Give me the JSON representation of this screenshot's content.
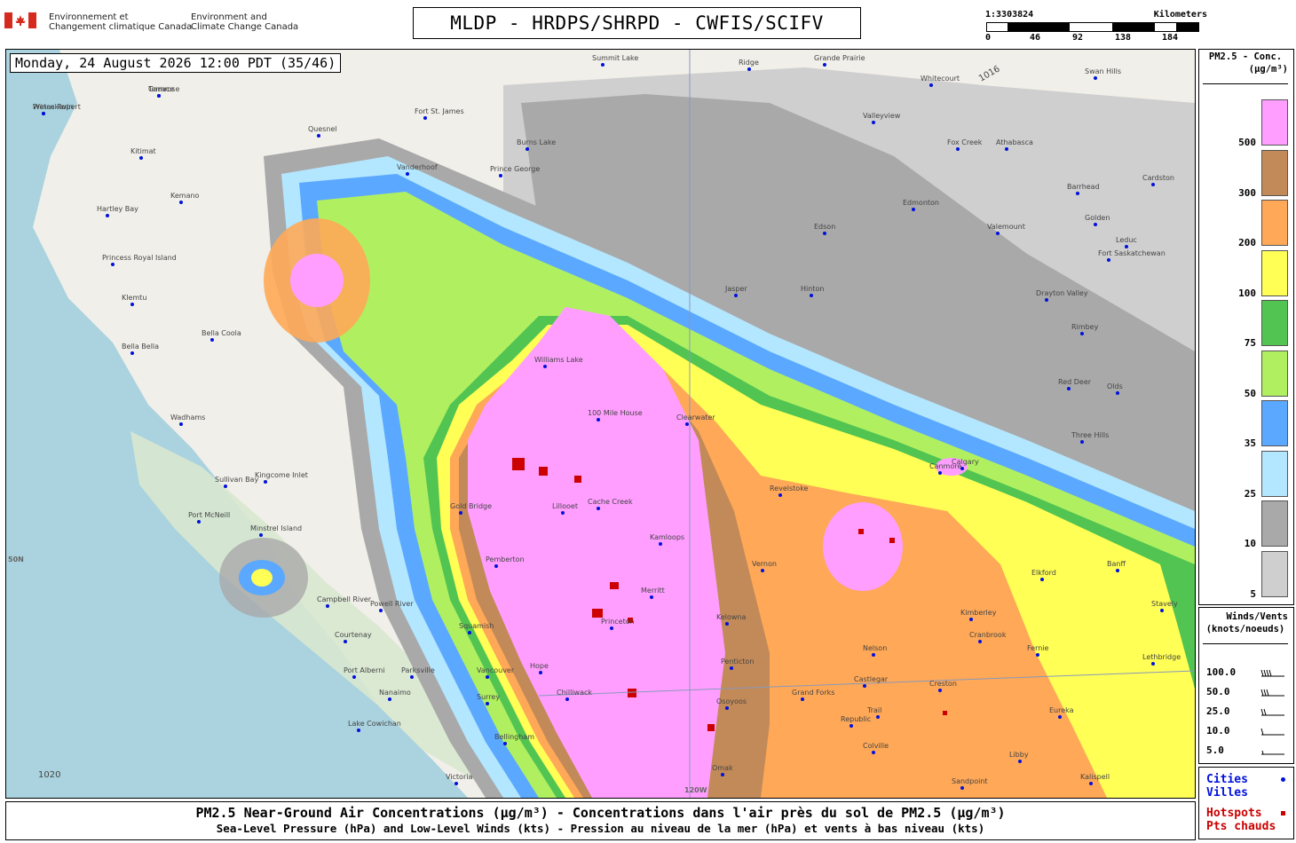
{
  "header": {
    "agency_fr_line1": "Environnement et",
    "agency_fr_line2": "Changement climatique Canada",
    "agency_en_line1": "Environment and",
    "agency_en_line2": "Climate Change Canada",
    "title": "MLDP - HRDPS/SHRPD - CWFIS/SCIFV",
    "scale_ratio": "1:3303824",
    "scale_unit": "Kilometers",
    "scale_ticks": [
      "0",
      "46",
      "92",
      "138",
      "184"
    ]
  },
  "map": {
    "datetime": "Monday, 24 August 2026 12:00 PDT (35/46)",
    "latitude_label": "50N",
    "longitude_label": "120W",
    "isobar_labels": [
      "1016",
      "1020"
    ],
    "place_labels": [
      "Prince Rupert",
      "Terrace",
      "Kitimat",
      "Kemano",
      "Hartley Bay",
      "Princess Royal Island",
      "Klemtu",
      "Bella Bella",
      "Bella Coola",
      "Wadhams",
      "Kingcome Inlet",
      "Sullivan Bay",
      "Port McNeill",
      "Minstrel Island",
      "Campbell River",
      "Courtenay",
      "Powell River",
      "Port Alberni",
      "Parksville",
      "Nanaimo",
      "Lake Cowichan",
      "Victoria",
      "Vancouver",
      "Surrey",
      "Bellingham",
      "Squamish",
      "Pemberton",
      "Gold Bridge",
      "Lillooet",
      "Cache Creek",
      "Kamloops",
      "Merritt",
      "Kelowna",
      "Penticton",
      "Osoyoos",
      "Chilliwack",
      "Hope",
      "Princeton",
      "Williams Lake",
      "100 Mile House",
      "Clearwater",
      "Revelstoke",
      "Vernon",
      "Nelson",
      "Castlegar",
      "Trail",
      "Cranbrook",
      "Kimberley",
      "Fernie",
      "Elkford",
      "Grand Forks",
      "Creston",
      "Libby",
      "Eureka",
      "Kalispell",
      "Sandpoint",
      "Omak",
      "Republic",
      "Colville",
      "Fort St. James",
      "Vanderhoof",
      "Prince George",
      "Quesnel",
      "Burns Lake",
      "Summit Lake",
      "Ridge",
      "Grande Prairie",
      "Valleyview",
      "Fox Creek",
      "Whitecourt",
      "Swan Hills",
      "Athabasca",
      "Barrhead",
      "Edmonton",
      "Edson",
      "Hinton",
      "Jasper",
      "Valemount",
      "Drayton Valley",
      "Rimbey",
      "Red Deer",
      "Olds",
      "Three Hills",
      "Calgary",
      "Canmore",
      "Banff",
      "Stavely",
      "Lethbridge",
      "Cardston",
      "Golden",
      "Fort Saskatchewan",
      "Leduc",
      "Wetaskiwin",
      "Camrose"
    ]
  },
  "legend": {
    "title_line1": "PM2.5 - Conc.",
    "title_line2": "(µg/m³)",
    "bins": [
      {
        "label": "500",
        "color": "#ff9eff"
      },
      {
        "label": "300",
        "color": "#c28a58"
      },
      {
        "label": "200",
        "color": "#ffa857"
      },
      {
        "label": "100",
        "color": "#ffff55"
      },
      {
        "label": "75",
        "color": "#52c452"
      },
      {
        "label": "50",
        "color": "#b0f060"
      },
      {
        "label": "35",
        "color": "#5aa8ff"
      },
      {
        "label": "25",
        "color": "#b3e6ff"
      },
      {
        "label": "10",
        "color": "#a9a9a9"
      },
      {
        "label": "5",
        "color": "#cfcfcf"
      }
    ]
  },
  "winds": {
    "title_line1": "Winds/Vents",
    "title_line2": "(knots/noeuds)",
    "rows": [
      "100.0",
      "50.0",
      "25.0",
      "10.0",
      "5.0"
    ]
  },
  "key": {
    "cities_en": "Cities",
    "cities_fr": "Villes",
    "hotspots_en": "Hotspots",
    "hotspots_fr": "Pts chauds",
    "city_color": "#0011dd",
    "hotspot_color": "#cc0000"
  },
  "caption": {
    "line1": "PM2.5 Near-Ground Air Concentrations (µg/m³) - Concentrations dans l'air près du sol de PM2.5 (µg/m³)",
    "line2": "Sea-Level Pressure (hPa) and Low-Level Winds (kts) - Pression au niveau de la mer (hPa) et vents à bas niveau (kts)"
  }
}
